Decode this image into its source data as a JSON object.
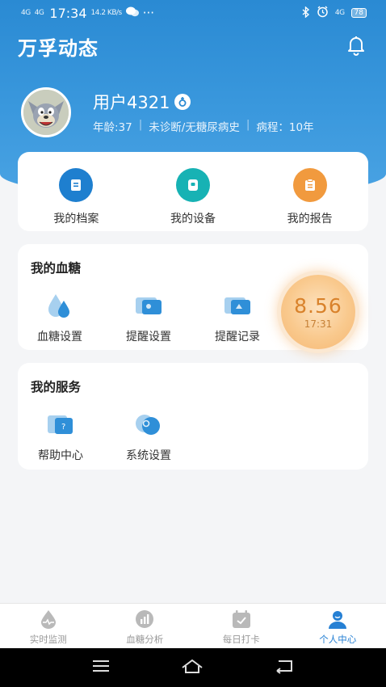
{
  "status_bar": {
    "signal1": "4G",
    "signal2": "4G",
    "time": "17:34",
    "speed": "14.2 KB/s",
    "more": "···",
    "network": "4G",
    "battery": "78"
  },
  "header": {
    "title": "万孚动态",
    "bell_icon": "bell-icon"
  },
  "user": {
    "name": "用户4321",
    "age": "年龄:37",
    "diagnosis": "未诊断/无糖尿病史",
    "course": "病程：10年"
  },
  "quick_links": [
    {
      "label": "我的档案",
      "icon": "profile-icon",
      "color": "#1e7fcf"
    },
    {
      "label": "我的设备",
      "icon": "device-icon",
      "color": "#17b2b4"
    },
    {
      "label": "我的报告",
      "icon": "report-icon",
      "color": "#f19a3e"
    }
  ],
  "blood_sugar": {
    "title": "我的血糖",
    "items": [
      {
        "label": "血糖设置",
        "icon": "blood-drop-icon"
      },
      {
        "label": "提醒设置",
        "icon": "reminder-settings-icon"
      },
      {
        "label": "提醒记录",
        "icon": "reminder-record-icon"
      }
    ],
    "latest_value": "8.56",
    "latest_time": "17:31"
  },
  "services": {
    "title": "我的服务",
    "items": [
      {
        "label": "帮助中心",
        "icon": "help-icon"
      },
      {
        "label": "系统设置",
        "icon": "settings-icon"
      }
    ]
  },
  "tabs": [
    {
      "label": "实时监测",
      "icon": "monitor-icon",
      "active": false
    },
    {
      "label": "血糖分析",
      "icon": "analysis-icon",
      "active": false
    },
    {
      "label": "每日打卡",
      "icon": "checkin-icon",
      "active": false
    },
    {
      "label": "个人中心",
      "icon": "person-icon",
      "active": true
    }
  ],
  "colors": {
    "primary": "#2a8ad3",
    "accent_active": "#2680d4",
    "glucose_orange": "#d9822b"
  }
}
